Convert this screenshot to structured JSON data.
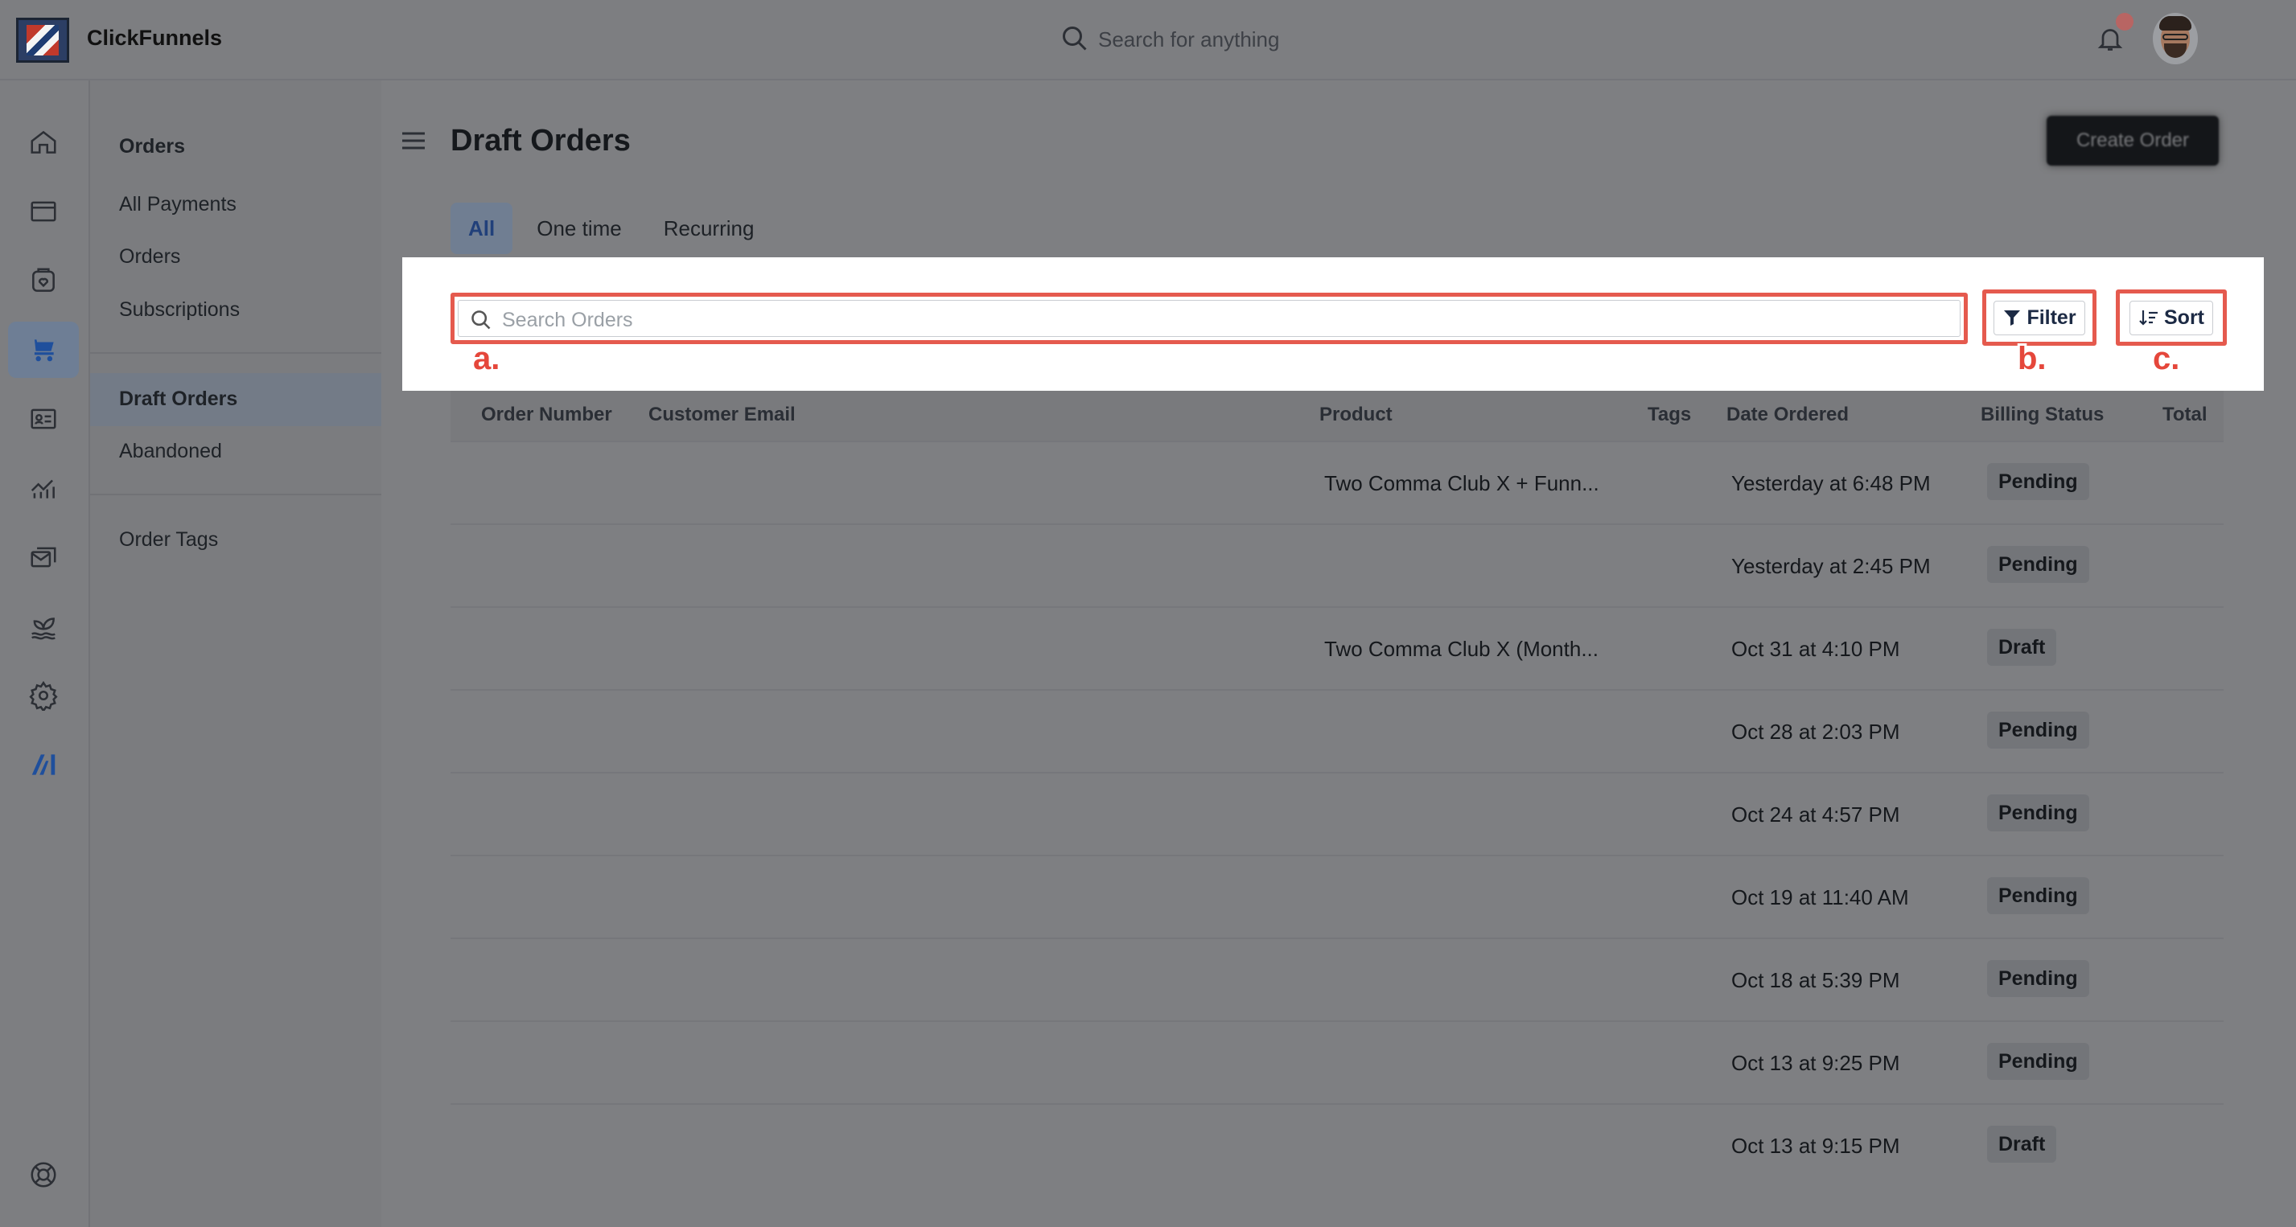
{
  "app": {
    "name": "ClickFunnels"
  },
  "topbar": {
    "search_placeholder": "Search for anything",
    "notification_dot_color": "#e05555"
  },
  "rail": {
    "icons": [
      "home-icon",
      "pages-icon",
      "store-icon",
      "orders-cart-icon",
      "contacts-card-icon",
      "analytics-icon",
      "email-icon",
      "automation-icon",
      "settings-icon",
      "ai-icon",
      "help-icon"
    ],
    "active": "orders-cart-icon"
  },
  "subnav": {
    "heading": "Orders",
    "items": [
      {
        "label": "All Payments"
      },
      {
        "label": "Orders"
      },
      {
        "label": "Subscriptions"
      },
      {
        "label": "Draft Orders",
        "active": true
      },
      {
        "label": "Abandoned"
      },
      {
        "label": "Order Tags"
      }
    ]
  },
  "page": {
    "title": "Draft Orders",
    "create_button": "Create Order",
    "tabs": [
      {
        "label": "All",
        "active": true
      },
      {
        "label": "One time"
      },
      {
        "label": "Recurring"
      }
    ]
  },
  "toolbar": {
    "search_placeholder": "Search Orders",
    "filter_label": "Filter",
    "sort_label": "Sort",
    "callouts": {
      "search": "a.",
      "filter": "b.",
      "sort": "c."
    },
    "highlight_color": "#e55a4e"
  },
  "table": {
    "columns": [
      "Order Number",
      "Customer Email",
      "Product",
      "Tags",
      "Date Ordered",
      "Billing Status",
      "Total"
    ],
    "rows": [
      {
        "order": "",
        "email": "",
        "product": "Two Comma Club X + Funn...",
        "tags": "",
        "date": "Yesterday at 6:48 PM",
        "status": "Pending",
        "total": ""
      },
      {
        "order": "",
        "email": "",
        "product": "",
        "tags": "",
        "date": "Yesterday at 2:45 PM",
        "status": "Pending",
        "total": ""
      },
      {
        "order": "",
        "email": "",
        "product": "Two Comma Club X (Month...",
        "tags": "",
        "date": "Oct 31 at 4:10 PM",
        "status": "Draft",
        "total": ""
      },
      {
        "order": "",
        "email": "",
        "product": "",
        "tags": "",
        "date": "Oct 28 at 2:03 PM",
        "status": "Pending",
        "total": ""
      },
      {
        "order": "",
        "email": "",
        "product": "",
        "tags": "",
        "date": "Oct 24 at 4:57 PM",
        "status": "Pending",
        "total": ""
      },
      {
        "order": "",
        "email": "",
        "product": "",
        "tags": "",
        "date": "Oct 19 at 11:40 AM",
        "status": "Pending",
        "total": ""
      },
      {
        "order": "",
        "email": "",
        "product": "",
        "tags": "",
        "date": "Oct 18 at 5:39 PM",
        "status": "Pending",
        "total": ""
      },
      {
        "order": "",
        "email": "",
        "product": "",
        "tags": "",
        "date": "Oct 13 at 9:25 PM",
        "status": "Pending",
        "total": ""
      },
      {
        "order": "",
        "email": "",
        "product": "",
        "tags": "",
        "date": "Oct 13 at 9:15 PM",
        "status": "Draft",
        "total": ""
      }
    ]
  }
}
